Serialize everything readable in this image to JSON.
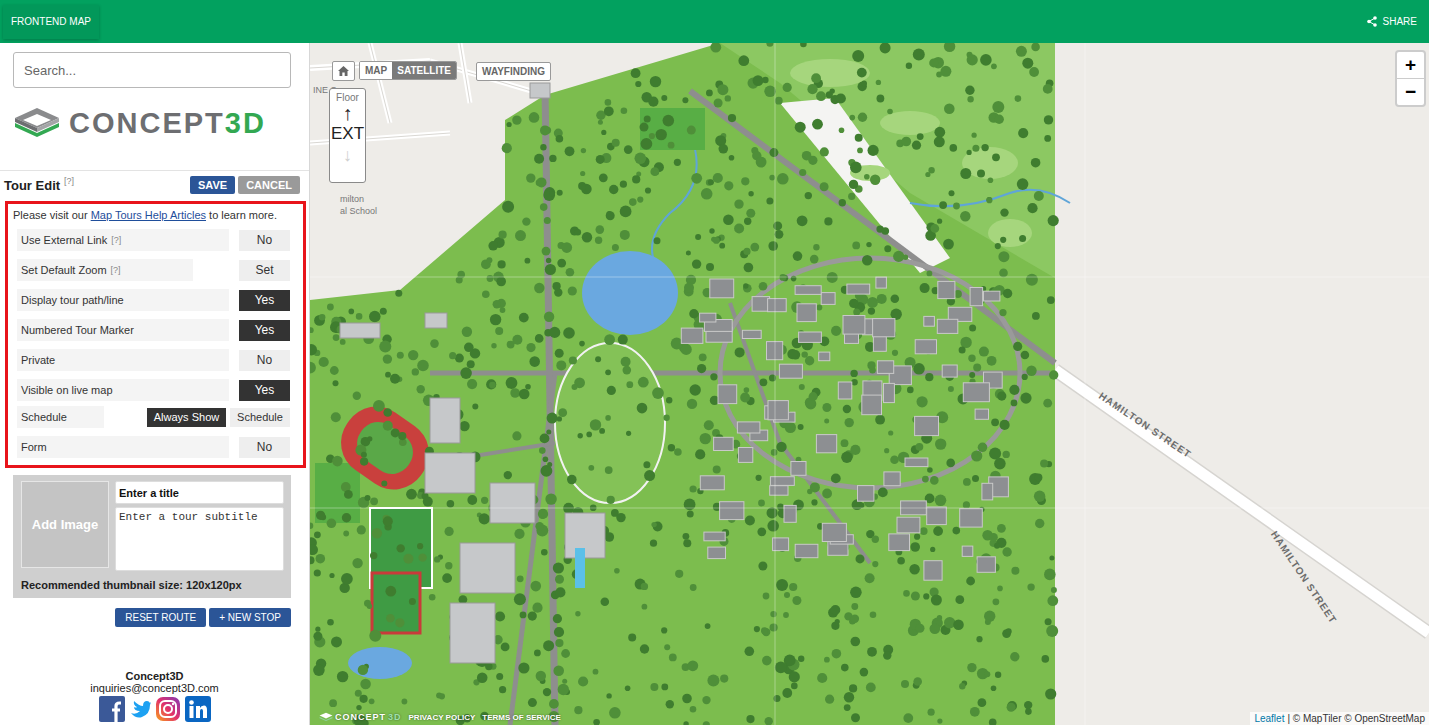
{
  "top_bar": {
    "left_button": "FRONTEND MAP",
    "share": "SHARE"
  },
  "sidebar": {
    "search": {
      "placeholder": "Search..."
    },
    "logo": {
      "word": "CONCEPT",
      "accent": "3D"
    },
    "tour_edit": {
      "title": "Tour Edit",
      "help": "[?]",
      "save": "SAVE",
      "cancel": "CANCEL"
    },
    "settings": {
      "intro_before": "Please visit our ",
      "intro_link": "Map Tours Help Articles",
      "intro_after": " to learn more.",
      "rows": [
        {
          "label": "Use External Link",
          "help": "[?]",
          "kind": "toggle",
          "value": "No",
          "on": false
        },
        {
          "label": "Set Default Zoom",
          "help": "[?]",
          "kind": "button",
          "value": "Set"
        },
        {
          "label": "Display tour path/line",
          "kind": "toggle",
          "value": "Yes",
          "on": true
        },
        {
          "label": "Numbered Tour Marker",
          "kind": "toggle",
          "value": "Yes",
          "on": true
        },
        {
          "label": "Private",
          "kind": "toggle",
          "value": "No",
          "on": false
        },
        {
          "label": "Visible on live map",
          "kind": "toggle",
          "value": "Yes",
          "on": true
        },
        {
          "label": "Schedule",
          "kind": "choice",
          "options": [
            {
              "label": "Always Show",
              "selected": true
            },
            {
              "label": "Schedule",
              "selected": false
            }
          ]
        },
        {
          "label": "Form",
          "kind": "toggle",
          "value": "No",
          "on": false
        }
      ]
    },
    "tour_card": {
      "image_button": "Add Image",
      "title_placeholder": "Enter a title",
      "subtitle_placeholder": "Enter a tour subtitle",
      "hint": "Recommended thumbnail size: 120x120px"
    },
    "route_buttons": [
      "RESET ROUTE",
      "+ NEW STOP"
    ],
    "footer": {
      "company": "Concept3D",
      "email": "inquiries@concept3D.com"
    }
  },
  "map": {
    "view_tabs": [
      {
        "label": "MAP",
        "selected": true
      },
      {
        "label": "SATELLITE",
        "selected": false
      }
    ],
    "wayfinding": "WAYFINDING",
    "floor": {
      "title": "Floor",
      "up": "↑",
      "current": "EXT",
      "down": "↓",
      "down_disabled": true
    },
    "zoom": [
      "+",
      "−"
    ],
    "labels": [
      "INE S",
      "milton",
      "al School",
      "HAMILTON STREET",
      "HAMILTON STREET"
    ],
    "footer_logo": {
      "word": "CONCEPT",
      "accent": "3D"
    },
    "footer_links": [
      "PRIVACY POLICY",
      "TERMS OF SERVICE"
    ],
    "attribution": {
      "leaflet": "Leaflet",
      "credits": "| © MapTiler © OpenStreetMap"
    }
  }
}
